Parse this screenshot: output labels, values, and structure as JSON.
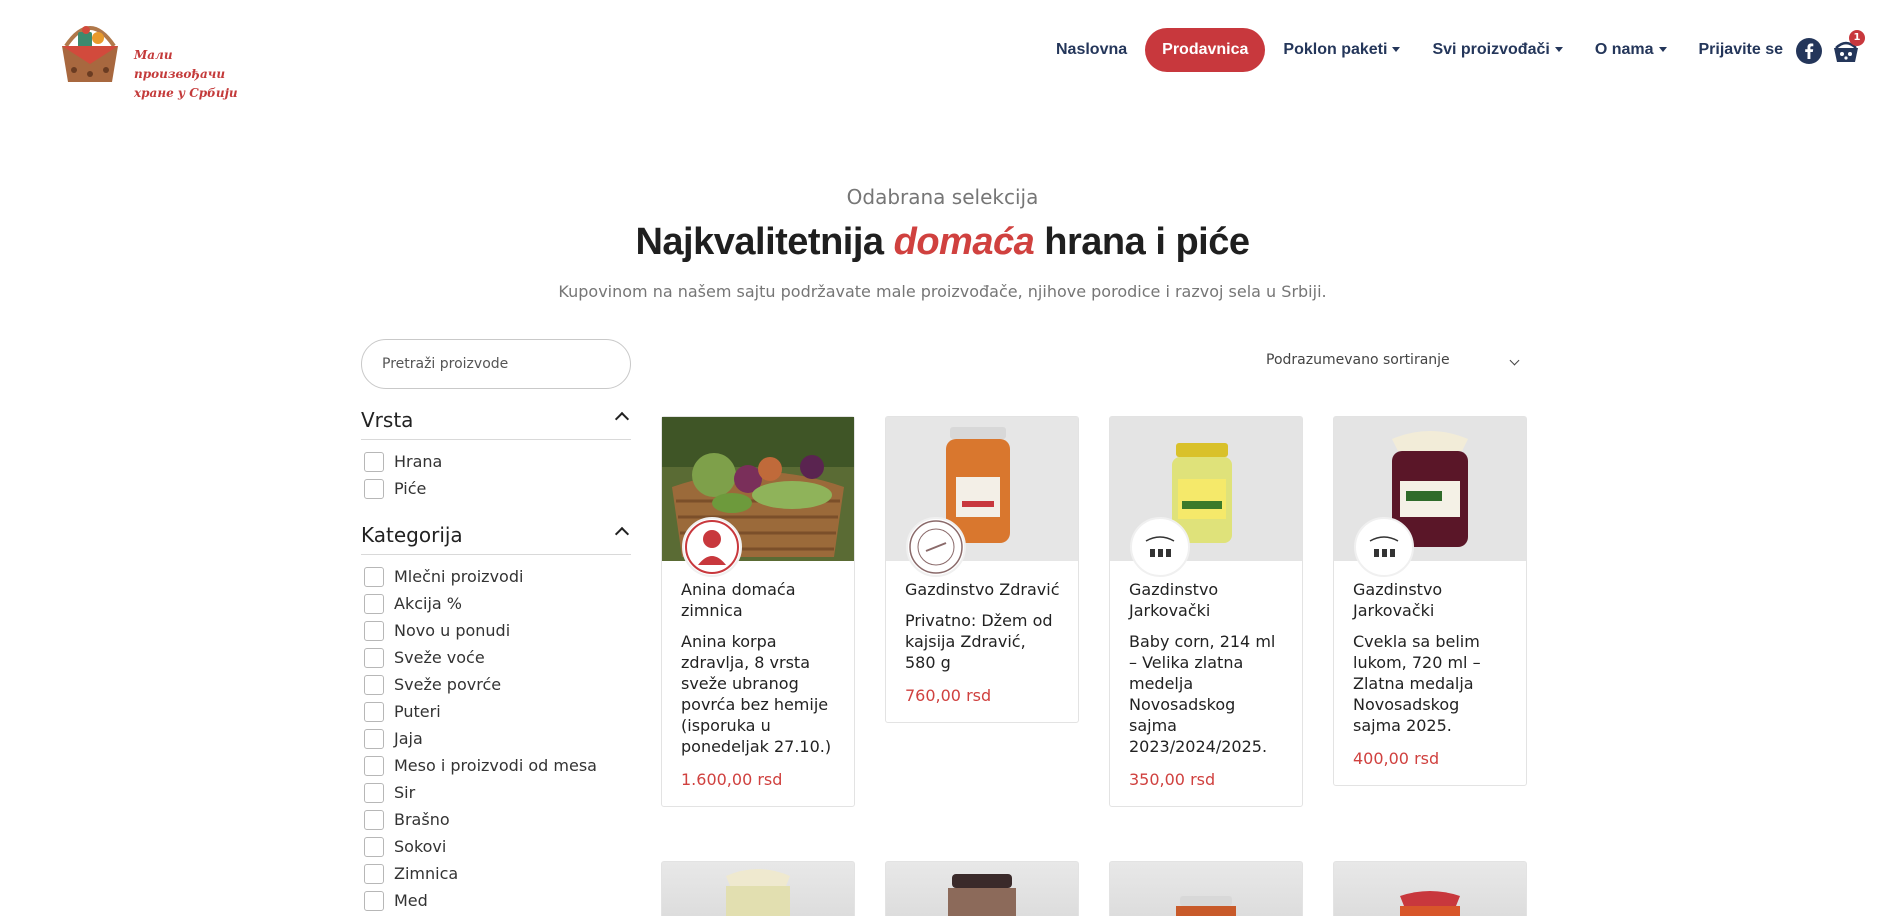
{
  "brand": {
    "logo_text_line1": "Мали произвођачи",
    "logo_text_line2": "хране у Србији"
  },
  "nav": {
    "items": [
      {
        "label": "Naslovna",
        "active": false,
        "dropdown": false
      },
      {
        "label": "Prodavnica",
        "active": true,
        "dropdown": false
      },
      {
        "label": "Poklon paketi",
        "active": false,
        "dropdown": true
      },
      {
        "label": "Svi proizvođači",
        "active": false,
        "dropdown": true
      },
      {
        "label": "O nama",
        "active": false,
        "dropdown": true
      },
      {
        "label": "Prijavite se",
        "active": false,
        "dropdown": false
      }
    ],
    "cart_count": "1",
    "icons": [
      "facebook-icon",
      "cart-icon"
    ]
  },
  "hero": {
    "eyebrow": "Odabrana selekcija",
    "headline_pre": "Najkvalitetnija",
    "headline_accent": "domaća",
    "headline_post": "hrana i piće",
    "subline": "Kupovinom na našem sajtu podržavate male proizvođače, njihove porodice i razvoj sela u Srbiji."
  },
  "search": {
    "placeholder": "Pretraži proizvode"
  },
  "sort": {
    "selected": "Podrazumevano sortiranje"
  },
  "filters": {
    "vrsta": {
      "title": "Vrsta",
      "options": [
        "Hrana",
        "Piće"
      ]
    },
    "kategorija": {
      "title": "Kategorija",
      "options": [
        "Mlečni proizvodi",
        "Akcija %",
        "Novo u ponudi",
        "Sveže voće",
        "Sveže povrće",
        "Puteri",
        "Jaja",
        "Meso i proizvodi od mesa",
        "Sir",
        "Brašno",
        "Sokovi",
        "Zimnica",
        "Med"
      ]
    }
  },
  "products": [
    {
      "maker": "Anina domaća zimnica",
      "name": "Anina korpa zdravlja, 8 vrsta sveže ubranog povrća bez hemije (isporuka u ponedeljak 27.10.)",
      "price": "1.600,00 rsd",
      "badge_text": "Anina zimnica"
    },
    {
      "maker": "Gazdinstvo Zdravić",
      "name": "Privatno: Džem od kajsija Zdravić, 580 g",
      "price": "760,00 rsd",
      "badge_text": ""
    },
    {
      "maker": "Gazdinstvo Jarkovački",
      "name": "Baby corn, 214 ml – Velika zlatna medelja Novosadskog sajma 2023/2024/2025.",
      "price": "350,00 rsd",
      "badge_text": ""
    },
    {
      "maker": "Gazdinstvo Jarkovački",
      "name": "Cvekla sa belim lukom, 720 ml – Zlatna medalja Novosadskog sajma 2025.",
      "price": "400,00 rsd",
      "badge_text": ""
    }
  ],
  "colors": {
    "accent": "#c8383d",
    "nav_text": "#24365a",
    "price": "#d0413f"
  }
}
